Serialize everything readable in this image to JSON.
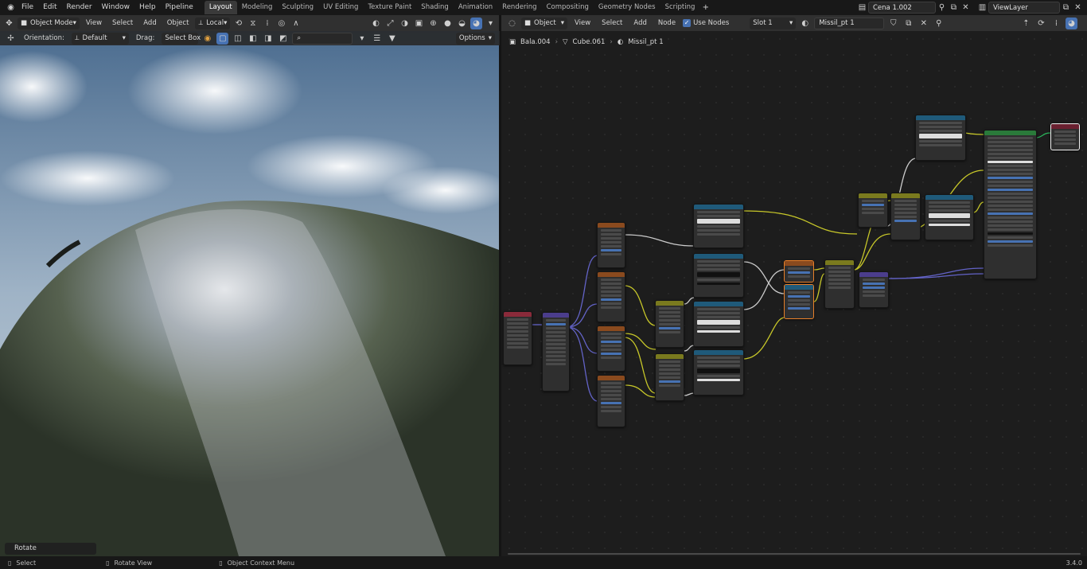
{
  "topbar": {
    "menus": [
      "File",
      "Edit",
      "Render",
      "Window",
      "Help",
      "Pipeline"
    ],
    "workspaces": [
      "Layout",
      "Modeling",
      "Sculpting",
      "UV Editing",
      "Texture Paint",
      "Shading",
      "Animation",
      "Rendering",
      "Compositing",
      "Geometry Nodes",
      "Scripting"
    ],
    "active_workspace": "Layout",
    "scene_name": "Cena 1.002",
    "view_layer": "ViewLayer"
  },
  "viewport": {
    "mode": "Object Mode",
    "menus": [
      "View",
      "Select",
      "Add",
      "Object"
    ],
    "transform_orientation": "Local",
    "orientation_label": "Orientation:",
    "orientation_value": "Default",
    "drag_label": "Drag:",
    "drag_value": "Select Box",
    "options_label": "Options",
    "last_operator": "Rotate"
  },
  "node_editor": {
    "object_type": "Object",
    "menus": [
      "View",
      "Select",
      "Add",
      "Node"
    ],
    "use_nodes_label": "Use Nodes",
    "use_nodes_checked": true,
    "slot": "Slot 1",
    "material": "Missil_pt 1",
    "breadcrumb": [
      "Bala.004",
      "Cube.061",
      "Missil_pt 1"
    ]
  },
  "statusbar": {
    "select": "Select",
    "rotate_view": "Rotate View",
    "context_menu": "Object Context Menu",
    "version": "3.4.0"
  }
}
